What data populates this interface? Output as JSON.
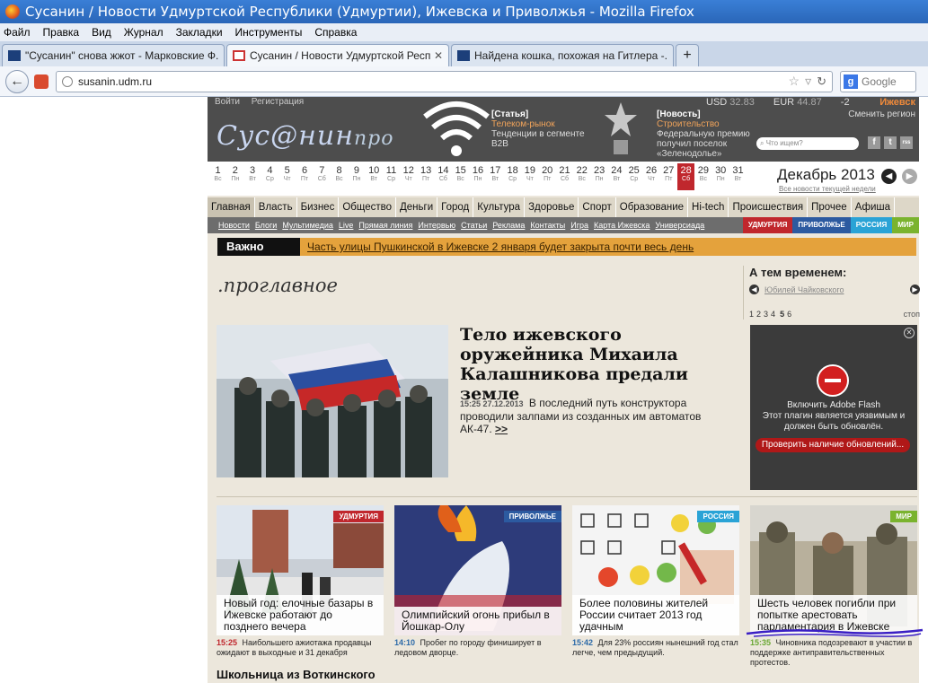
{
  "window": {
    "title": "Сусанин / Новости Удмуртской Республики (Удмуртии), Ижевска и Приволжья - Mozilla Firefox"
  },
  "menu": [
    "Файл",
    "Правка",
    "Вид",
    "Журнал",
    "Закладки",
    "Инструменты",
    "Справка"
  ],
  "tabs": [
    {
      "title": "\"Сусанин\" снова жжот - Марковские Ф..."
    },
    {
      "title": "Сусанин / Новости Удмуртской Республ..."
    },
    {
      "title": "Найдена кошка, похожая на Гитлера -..."
    }
  ],
  "nav": {
    "url": "susanin.udm.ru",
    "search_placeholder": "Google"
  },
  "site": {
    "header": {
      "login": "Войти",
      "register": "Регистрация",
      "usd_label": "USD",
      "usd_value": "32.83",
      "eur_label": "EUR",
      "eur_value": "44.87",
      "temp": "-2",
      "city": "Ижевск",
      "change_region": "Сменить регион",
      "logo": "Сус@нин",
      "logo_suffix": "про",
      "promo1_tag": "[Статья]",
      "promo1_sub": "Телеком-рынок",
      "promo1_text": "Тенденции в сегменте B2B",
      "promo2_tag": "[Новость]",
      "promo2_sub": "Строительство",
      "promo2_text": "Федеральную премию получил поселок «Зеленодолье»",
      "search_placeholder": "Что ищем?",
      "social": [
        "f",
        "t",
        "rss"
      ]
    },
    "calendar": {
      "days": [
        {
          "n": "1",
          "w": "Вс"
        },
        {
          "n": "2",
          "w": "Пн"
        },
        {
          "n": "3",
          "w": "Вт"
        },
        {
          "n": "4",
          "w": "Ср"
        },
        {
          "n": "5",
          "w": "Чт"
        },
        {
          "n": "6",
          "w": "Пт"
        },
        {
          "n": "7",
          "w": "Сб"
        },
        {
          "n": "8",
          "w": "Вс"
        },
        {
          "n": "9",
          "w": "Пн"
        },
        {
          "n": "10",
          "w": "Вт"
        },
        {
          "n": "11",
          "w": "Ср"
        },
        {
          "n": "12",
          "w": "Чт"
        },
        {
          "n": "13",
          "w": "Пт"
        },
        {
          "n": "14",
          "w": "Сб"
        },
        {
          "n": "15",
          "w": "Вс"
        },
        {
          "n": "16",
          "w": "Пн"
        },
        {
          "n": "17",
          "w": "Вт"
        },
        {
          "n": "18",
          "w": "Ср"
        },
        {
          "n": "19",
          "w": "Чт"
        },
        {
          "n": "20",
          "w": "Пт"
        },
        {
          "n": "21",
          "w": "Сб"
        },
        {
          "n": "22",
          "w": "Вс"
        },
        {
          "n": "23",
          "w": "Пн"
        },
        {
          "n": "24",
          "w": "Вт"
        },
        {
          "n": "25",
          "w": "Ср"
        },
        {
          "n": "26",
          "w": "Чт"
        },
        {
          "n": "27",
          "w": "Пт"
        },
        {
          "n": "28",
          "w": "Сб"
        },
        {
          "n": "29",
          "w": "Вс"
        },
        {
          "n": "30",
          "w": "Пн"
        },
        {
          "n": "31",
          "w": "Вт"
        }
      ],
      "current_day": "28",
      "month": "Декабрь 2013",
      "all_news": "Все новости текущей недели"
    },
    "main_nav": [
      "Главная",
      "Власть",
      "Бизнес",
      "Общество",
      "Деньги",
      "Город",
      "Культура",
      "Здоровье",
      "Спорт",
      "Образование",
      "Hi-tech",
      "Происшествия",
      "Прочее",
      "Афиша"
    ],
    "sub_nav": [
      "Новости",
      "Блоги",
      "Мультимедиа",
      "Live",
      "Прямая линия",
      "Интервью",
      "Статьи",
      "Реклама",
      "Контакты",
      "Игра",
      "Карта Ижевска",
      "Универсиада"
    ],
    "region_tags": [
      {
        "label": "УДМУРТИЯ",
        "color": "#c0272d"
      },
      {
        "label": "ПРИВОЛЖЬЕ",
        "color": "#2c5aa0"
      },
      {
        "label": "РОССИЯ",
        "color": "#2aa3d6"
      },
      {
        "label": "МИР",
        "color": "#7ab32e"
      }
    ],
    "important": {
      "label": "Важно",
      "text": "Часть улицы Пушкинской в Ижевске 2 января будет закрыта почти весь день"
    },
    "main_logo": ".проглавное",
    "meanwhile": {
      "title": "А тем временем:",
      "link": "Юбилей Чайковского",
      "pages": [
        "1",
        "2",
        "3",
        "4",
        "5",
        "6"
      ],
      "current_page": "5",
      "stop": "стоп"
    },
    "top_story": {
      "headline": "Тело ижевского оружейника Михаила Калашникова предали земле",
      "time": "15:25 27.12.2013",
      "lead": "В последний путь конструктора проводили залпами из созданных им автоматов АК-47.",
      "more": ">>"
    },
    "flash": {
      "line1": "Включить Adobe Flash",
      "line2": "Этот плагин является уязвимым и должен быть обновлён.",
      "button": "Проверить наличие обновлений..."
    },
    "cards": [
      {
        "tag": "УДМУРТИЯ",
        "tag_color": "#c0272d",
        "title": "Новый год: елочные базары в Ижевске работают до позднего вечера",
        "time": "15:25",
        "text": "Наибольшего ажиотажа продавцы ожидают в выходные и 31 декабря"
      },
      {
        "tag": "ПРИВОЛЖЬЕ",
        "tag_color": "#2c5aa0",
        "title": "Олимпийский огонь прибыл в Йошкар-Олу",
        "time": "14:10",
        "text": "Пробег по городу финиширует в ледовом дворце."
      },
      {
        "tag": "РОССИЯ",
        "tag_color": "#2aa3d6",
        "title": "Более половины жителей России считает 2013 год удачным",
        "time": "15:42",
        "text": "Для 23% россиян нынешний год стал легче, чем предыдущий."
      },
      {
        "tag": "МИР",
        "tag_color": "#7ab32e",
        "title": "Шесть человек погибли при попытке арестовать парламентария в Ижевске",
        "time": "15:35",
        "text": "Чиновника подозревают в участии в поддержке антиправительственных протестов."
      }
    ],
    "bottom_headline": "Школьница из Воткинского"
  }
}
